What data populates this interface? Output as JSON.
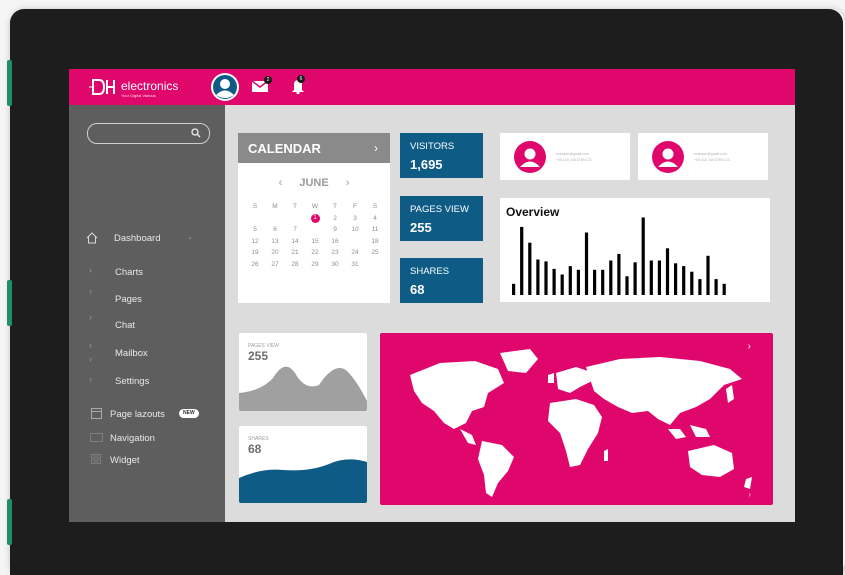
{
  "brand": {
    "name": "electronics",
    "tagline": "Your Digital Various",
    "color": "#e0076c"
  },
  "topbar": {
    "icons": [
      "user-avatar-icon",
      "mail-icon",
      "bell-icon"
    ],
    "mail_badge": "2",
    "bell_badge": "6"
  },
  "sidebar": {
    "search": {
      "placeholder": ""
    },
    "items": [
      {
        "label": "Dashboard",
        "icon": "home-icon",
        "expanded": true
      },
      {
        "label": "Charts"
      },
      {
        "label": "Pages"
      },
      {
        "label": "Chat"
      },
      {
        "label": "Mailbox"
      },
      {
        "label": "Settings"
      },
      {
        "label": "Page lazouts",
        "icon": "page-layout-icon",
        "badge": "NEW"
      },
      {
        "label": "Navigation",
        "icon": "navigation-icon"
      },
      {
        "label": "Widget",
        "icon": "widget-icon"
      }
    ]
  },
  "calendar": {
    "title": "CALENDAR",
    "next": "›",
    "month": "JUNE",
    "prev_arrow": "‹",
    "next_arrow": "›",
    "weekdays": [
      "S",
      "M",
      "T",
      "W",
      "T",
      "F",
      "S"
    ],
    "rows": [
      [
        "",
        "",
        "",
        "1",
        "2",
        "3",
        "4"
      ],
      [
        "5",
        "6",
        "7",
        "",
        "9",
        "10",
        "11"
      ],
      [
        "12",
        "13",
        "14",
        "15",
        "16",
        "",
        "18"
      ],
      [
        "19",
        "20",
        "21",
        "22",
        "23",
        "24",
        "25"
      ],
      [
        "26",
        "27",
        "28",
        "29",
        "30",
        "31",
        ""
      ]
    ],
    "selected_day": "1"
  },
  "stats": [
    {
      "label": "VISITORS",
      "value": "1,695"
    },
    {
      "label": "PAGES VIEW",
      "value": "255"
    },
    {
      "label": "SHARES",
      "value": "68"
    }
  ],
  "profiles": [
    {
      "line1": "example@gmail.com",
      "line2": "+00 (12) 345 6789 123"
    },
    {
      "line1": "example@gmail.com",
      "line2": "+00 (12) 345 6789 123"
    }
  ],
  "overview": {
    "title": "Overview"
  },
  "chart_data": {
    "type": "bar",
    "title": "Overview",
    "values": [
      12,
      73,
      56,
      38,
      36,
      28,
      22,
      31,
      27,
      67,
      27,
      27,
      37,
      44,
      20,
      35,
      83,
      37,
      37,
      50,
      34,
      31,
      25,
      17,
      42,
      17,
      12
    ],
    "color": "#000000"
  },
  "mini_cards": [
    {
      "label": "PAGES VIEW",
      "value": "255",
      "color": "#a0a0a0"
    },
    {
      "label": "SHARES",
      "value": "68",
      "color": "#0e5b86"
    }
  ],
  "map": {
    "arrow_top": "›",
    "arrow_bottom": "›"
  },
  "colors": {
    "accent": "#e0076c",
    "blue": "#0e5b86",
    "sidebar": "#5e5e5e"
  }
}
